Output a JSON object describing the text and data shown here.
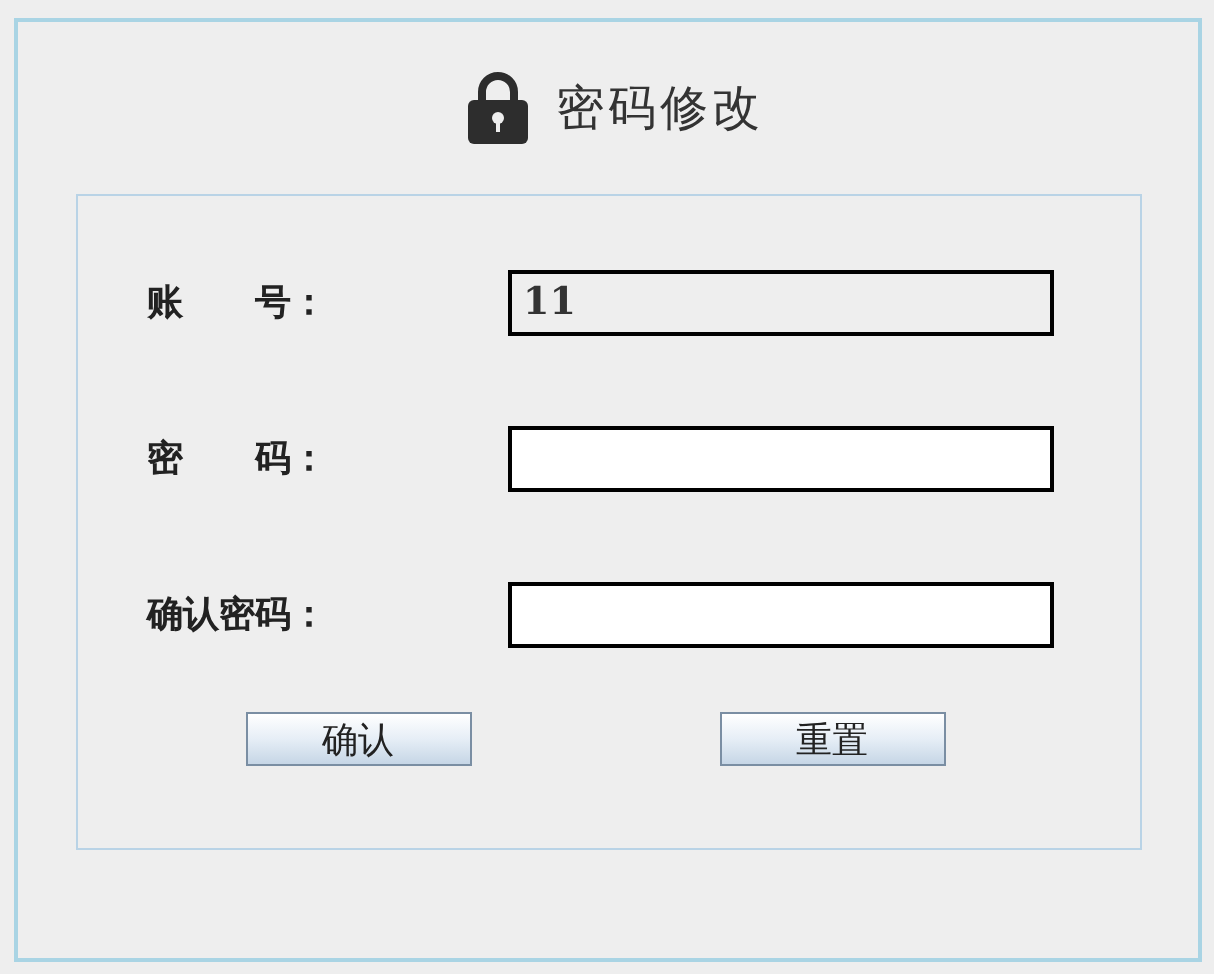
{
  "title": "密码修改",
  "fields": [
    {
      "label": "账　　号：",
      "value": "11",
      "disabled": true
    },
    {
      "label": "密　　码：",
      "disabled": false
    },
    {
      "label": "确认密码：",
      "disabled": false
    }
  ],
  "buttons": [
    "确认",
    "重置"
  ]
}
